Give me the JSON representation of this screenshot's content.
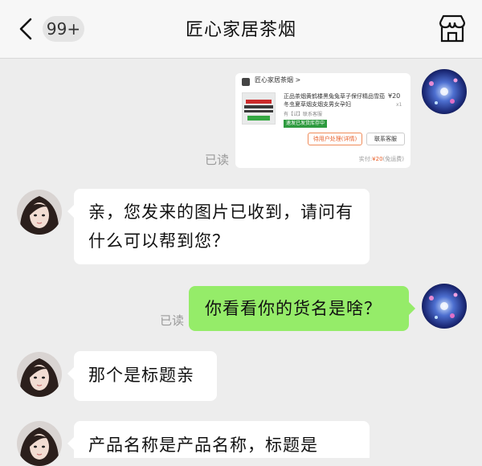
{
  "header": {
    "unread_badge": "99+",
    "title": "匠心家居茶烟"
  },
  "messages": {
    "card": {
      "shop_name": "匠心家居茶烟 >",
      "product_title": "正品茶烟黄鹤楼黑兔兔草子保仔精品雪茄冬虫夏草烟支烟支男女孕妇",
      "price": "¥20",
      "quantity": "x1",
      "subtitle": "有【试】联系客服",
      "tag": "速发已发货库存中",
      "button_pending": "待用户处理(详情)",
      "button_contact": "联系客服",
      "total_label": "实付:",
      "total_amount": "¥20",
      "total_note": "(免运费)"
    },
    "read_label": "已读",
    "incoming_1": "亲，您发来的图片已收到，请问有什么可以帮到您？",
    "outgoing_1": "你看看你的货名是啥？",
    "incoming_2": "那个是标题亲",
    "incoming_3": "产品名称是产品名称，标题是"
  },
  "colors": {
    "outgoing_bubble": "#95ec69",
    "incoming_bubble": "#ffffff",
    "background": "#ededed"
  },
  "icons": {
    "back": "chevron-left-icon",
    "store": "store-icon"
  }
}
